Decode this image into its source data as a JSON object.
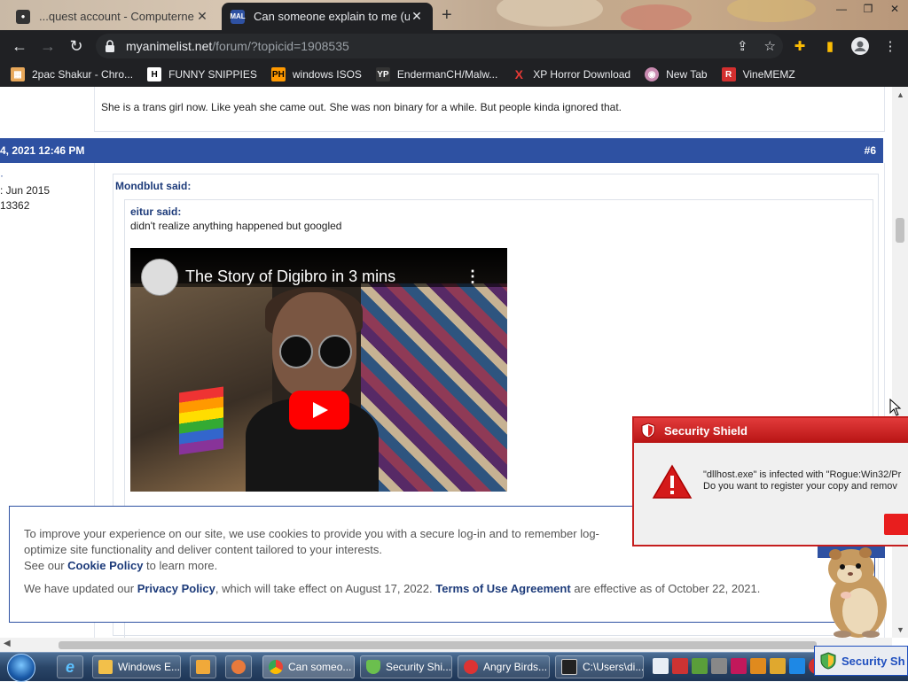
{
  "browser": {
    "tabs": [
      {
        "title": "...quest account - Computerne",
        "active": false
      },
      {
        "title": "Can someone explain to me (unr",
        "active": true
      }
    ],
    "active_tab_favicon": "MAL",
    "url_domain": "myanimelist.net",
    "url_path": "/forum/?topicid=1908535",
    "bookmarks": [
      {
        "label": "2pac Shakur - Chro...",
        "icon": "store-icon"
      },
      {
        "label": "FUNNY SNIPPIES",
        "icon": "H"
      },
      {
        "label": "windows ISOS",
        "icon": "PH"
      },
      {
        "label": "EndermanCH/Malw...",
        "icon": "YP"
      },
      {
        "label": "XP Horror Download",
        "icon": "X"
      },
      {
        "label": "New Tab",
        "icon": "globe-icon"
      },
      {
        "label": "VineMEMZ",
        "icon": "R"
      }
    ]
  },
  "forum": {
    "previous_post_text": "She is a trans girl now. Like yeah she came out. She was non binary for a while. But people kinda ignored that.",
    "post_date": "4, 2021 12:46 PM",
    "post_number": "#6",
    "user_joined": ": Jun 2015",
    "user_posts": "13362",
    "outer_quote_author": "Mondblut said:",
    "inner_quote_author": "eitur said:",
    "inner_quote_text": "didn't realize anything happened but googled",
    "video_title": "The Story of Digibro in 3 mins"
  },
  "cookie_banner": {
    "line1": "To improve your experience on our site, we use cookies to provide you with a secure log-in and to remember log-",
    "line2": "optimize site functionality and deliver content tailored to your interests.",
    "line3_prefix": "See our",
    "cookie_policy_link": "Cookie Policy",
    "line3_suffix": "to learn more.",
    "line4_prefix": "We have updated our",
    "privacy_policy_link": "Privacy Policy",
    "line4_middle": ", which will take effect on August 17, 2022.",
    "terms_link": "Terms of Use Agreement",
    "line4_suffix": "are effective as of October 22, 2021."
  },
  "security_popup": {
    "title": "Security Shield",
    "message_line1": "\"dllhost.exe\" is infected with \"Rogue:Win32/Pr",
    "message_line2": "Do you want to register your copy and remov"
  },
  "taskbar": {
    "items": [
      {
        "label": "Windows E...",
        "icon": "folder-icon"
      },
      {
        "label": "Can someo...",
        "icon": "chrome-icon"
      },
      {
        "label": "Security Shi...",
        "icon": "shield-icon"
      },
      {
        "label": "Angry Birds...",
        "icon": "angry-birds-icon"
      },
      {
        "label": "C:\\Users\\di...",
        "icon": "7zip-icon"
      }
    ],
    "security_tray_label": "Security Sh"
  },
  "colors": {
    "forum_blue": "#2e51a2",
    "popup_red": "#c51e1e",
    "chrome_dark": "#202124"
  }
}
